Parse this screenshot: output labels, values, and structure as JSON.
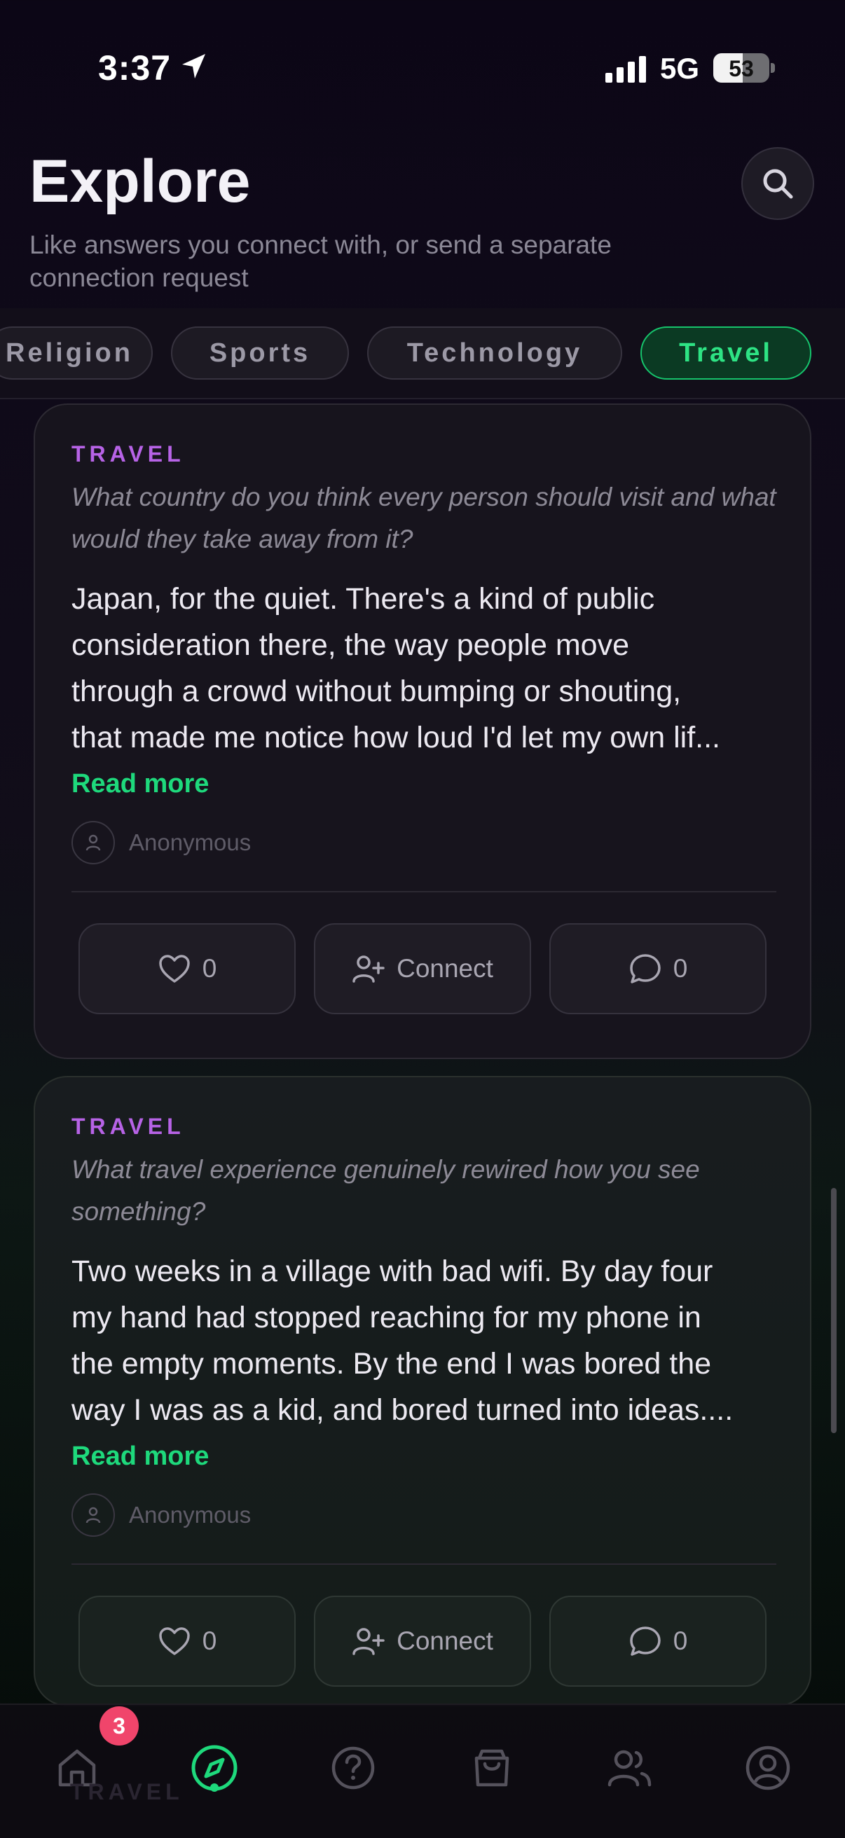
{
  "status": {
    "time": "3:37",
    "network": "5G",
    "battery": "53",
    "battery_level": 0.53
  },
  "header": {
    "title": "Explore",
    "subtitle": "Like answers you connect with, or send a separate connection request"
  },
  "filters": [
    {
      "label": "Religion",
      "active": false
    },
    {
      "label": "Sports",
      "active": false
    },
    {
      "label": "Technology",
      "active": false
    },
    {
      "label": "Travel",
      "active": true
    }
  ],
  "cards": [
    {
      "category": "TRAVEL",
      "question": "What country do you think every person should visit and what would they take away from it?",
      "answer": "Japan, for the quiet. There's a kind of public\nconsideration there, the way people move\nthrough a crowd without bumping or shouting,\nthat made me notice how loud I'd let my own lif...",
      "read_more": "Read more",
      "author": "Anonymous",
      "likes": "0",
      "connect_label": "Connect",
      "comments": "0"
    },
    {
      "category": "TRAVEL",
      "question": "What travel experience genuinely rewired how you see something?",
      "answer": "Two weeks in a village with bad wifi. By day four\nmy hand had stopped reaching for my phone in\nthe empty moments. By the end I was bored the\nway I was as a kid, and bored turned into ideas....",
      "read_more": "Read more",
      "author": "Anonymous",
      "likes": "0",
      "connect_label": "Connect",
      "comments": "0"
    }
  ],
  "next_card": {
    "category": "TRAVEL"
  },
  "tabbar": {
    "home_badge": "3",
    "tabs": [
      "home-icon",
      "compass-icon",
      "question-icon",
      "shopping-bag-icon",
      "people-icon",
      "profile-icon"
    ],
    "active_tab": "compass-icon"
  },
  "colors": {
    "accent": "#1ed97c",
    "category": "#b763e6",
    "badge": "#f0456b"
  }
}
